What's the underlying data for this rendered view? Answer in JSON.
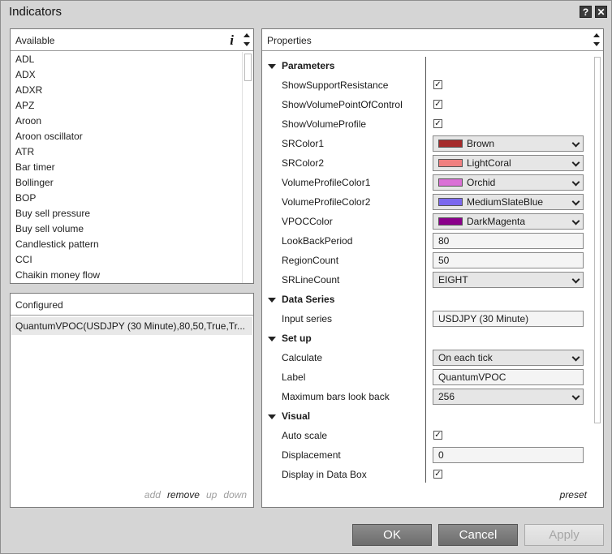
{
  "window": {
    "title": "Indicators",
    "help_label": "?",
    "close_label": "✕"
  },
  "available": {
    "header": "Available",
    "info_label": "i",
    "items": [
      "ADL",
      "ADX",
      "ADXR",
      "APZ",
      "Aroon",
      "Aroon oscillator",
      "ATR",
      "Bar timer",
      "Bollinger",
      "BOP",
      "Buy sell pressure",
      "Buy sell volume",
      "Candlestick pattern",
      "CCI",
      "Chaikin money flow"
    ]
  },
  "configured": {
    "header": "Configured",
    "item": "QuantumVPOC(USDJPY (30 Minute),80,50,True,Tr...",
    "actions": {
      "add": "add",
      "remove": "remove",
      "up": "up",
      "down": "down"
    }
  },
  "properties": {
    "header": "Properties",
    "preset_label": "preset",
    "categories": {
      "parameters": "Parameters",
      "data_series": "Data Series",
      "setup": "Set up",
      "visual": "Visual"
    },
    "rows": {
      "show_sr": {
        "label": "ShowSupportResistance",
        "checked": true,
        "check": "✓"
      },
      "show_vpoc": {
        "label": "ShowVolumePointOfControl",
        "checked": true,
        "check": "✓"
      },
      "show_vp": {
        "label": "ShowVolumeProfile",
        "checked": true,
        "check": "✓"
      },
      "srcolor1": {
        "label": "SRColor1",
        "value": "Brown",
        "color": "#a52a2a"
      },
      "srcolor2": {
        "label": "SRColor2",
        "value": "LightCoral",
        "color": "#f08080"
      },
      "vpcolor1": {
        "label": "VolumeProfileColor1",
        "value": "Orchid",
        "color": "#da70d6"
      },
      "vpcolor2": {
        "label": "VolumeProfileColor2",
        "value": "MediumSlateBlue",
        "color": "#7b68ee"
      },
      "vpoccolor": {
        "label": "VPOCColor",
        "value": "DarkMagenta",
        "color": "#8b008b"
      },
      "lookback": {
        "label": "LookBackPeriod",
        "value": "80"
      },
      "regioncount": {
        "label": "RegionCount",
        "value": "50"
      },
      "srlinecount": {
        "label": "SRLineCount",
        "value": "EIGHT"
      },
      "input_series": {
        "label": "Input series",
        "value": "USDJPY (30 Minute)"
      },
      "calculate": {
        "label": "Calculate",
        "value": "On each tick"
      },
      "label": {
        "label": "Label",
        "value": "QuantumVPOC"
      },
      "max_bars": {
        "label": "Maximum bars look back",
        "value": "256"
      },
      "auto_scale": {
        "label": "Auto scale",
        "checked": true,
        "check": "✓"
      },
      "displacement": {
        "label": "Displacement",
        "value": "0"
      },
      "display_databox": {
        "label": "Display in Data Box",
        "checked": true,
        "check": "✓"
      }
    }
  },
  "buttons": {
    "ok": "OK",
    "cancel": "Cancel",
    "apply": "Apply"
  }
}
